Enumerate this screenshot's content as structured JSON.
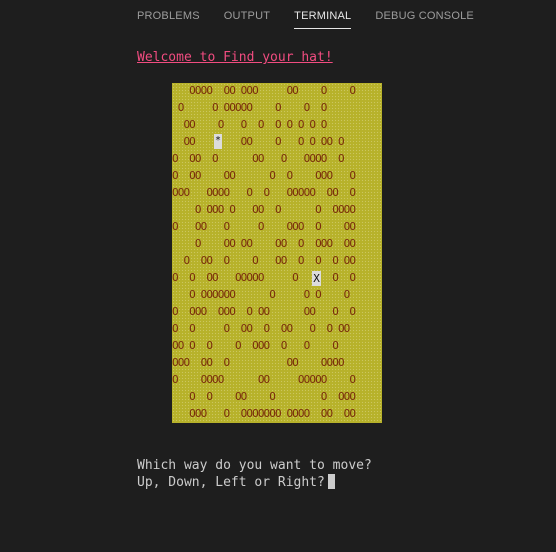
{
  "tabs": [
    "PROBLEMS",
    "OUTPUT",
    "TERMINAL",
    "DEBUG CONSOLE"
  ],
  "active_tab": "TERMINAL",
  "welcome": "Welcome to Find your hat!",
  "board": {
    "lines": [
      "   OOOO  OO OOO     OO    O    O",
      " O     O OOOOO    O    O  O",
      "  OO    O   O  O  O O O O O",
      "  OO        OO    O   O O OO O",
      "O  OO  O      OO   O   OOOO  O",
      "O  OO    OO      O  O    OOO   O",
      "OOO   OOOO   O  O   OOOOO  OO  O",
      "    O OOO O   OO  O      O  OOOO",
      "O   OO   O     O    OOO  O    OO",
      "    O    OO OO    OO  O  OOO  OO",
      "  O  OO  O    O   OO  O  O  O OO",
      "O  O  OO   OOOOO     O      O  O",
      "   O OOOOOO      O     O O    O",
      "O  OOO  OOO  O OO      OO   O  O",
      "O  O     O  OO  O  OO   O  O OO",
      "OO O  O    O  OOO  O   O    O",
      "OOO  OO  O          OO    OOOO",
      "O    OOOO      OO     OOOOO    O",
      "   O  O    OO    O        O  OOO",
      "   OOO   O  OOOOOOO OOOO  OO  OO",
      "",
      ""
    ],
    "player": "*",
    "hat": "X"
  },
  "prompt": {
    "line1": "Which way do you want to move?",
    "line2": "Up, Down, Left or Right?"
  }
}
